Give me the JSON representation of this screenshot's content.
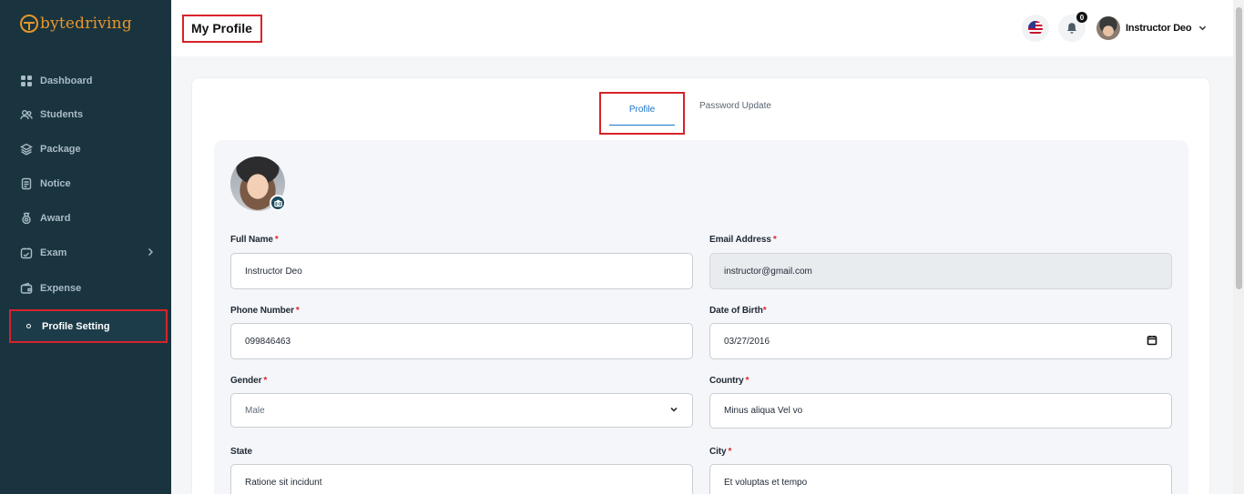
{
  "brand": {
    "name": "bytedriving"
  },
  "sidebar": {
    "items": [
      {
        "label": "Dashboard",
        "icon": "grid-icon"
      },
      {
        "label": "Students",
        "icon": "users-icon"
      },
      {
        "label": "Package",
        "icon": "layers-icon"
      },
      {
        "label": "Notice",
        "icon": "document-icon"
      },
      {
        "label": "Award",
        "icon": "award-icon"
      },
      {
        "label": "Exam",
        "icon": "exam-icon"
      },
      {
        "label": "Expense",
        "icon": "wallet-icon"
      },
      {
        "label": "Profile Setting",
        "icon": "dot-icon",
        "active": true
      }
    ]
  },
  "header": {
    "title": "My Profile",
    "notifications_count": "0",
    "user_name": "Instructor Deo"
  },
  "tabs": {
    "profile": "Profile",
    "password": "Password Update"
  },
  "form": {
    "full_name": {
      "label": "Full Name",
      "value": "Instructor Deo",
      "required": "*"
    },
    "email": {
      "label": "Email Address",
      "value": "instructor@gmail.com",
      "required": "*"
    },
    "phone": {
      "label": "Phone Number",
      "value": "099846463",
      "required": "*"
    },
    "dob": {
      "label": "Date of Birth",
      "value": "03/27/2016",
      "required": "*"
    },
    "gender": {
      "label": "Gender",
      "value": "Male",
      "required": "*"
    },
    "country": {
      "label": "Country",
      "value": "Minus aliqua Vel vo",
      "required": "*"
    },
    "state": {
      "label": "State",
      "value": "Ratione sit incidunt"
    },
    "city": {
      "label": "City",
      "value": "Et voluptas et tempo",
      "required": "*"
    }
  },
  "colors": {
    "sidebar_bg": "#19343f",
    "brand": "#e8962a",
    "accent": "#1a73c7",
    "required": "#e0242c",
    "highlight": "#d6232a"
  }
}
